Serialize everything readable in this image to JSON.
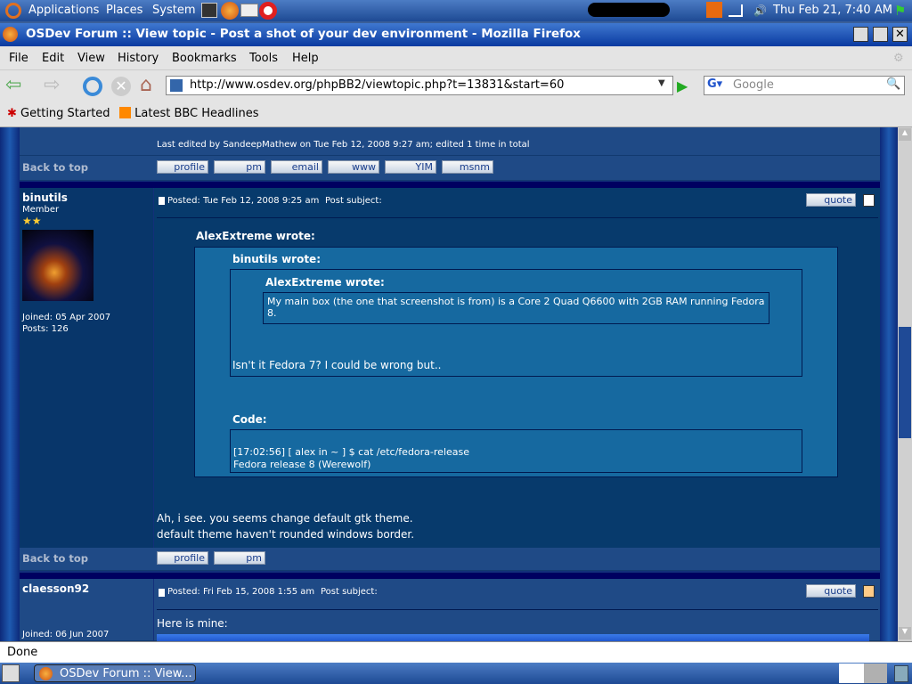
{
  "panel": {
    "applications": "Applications",
    "places": "Places",
    "system": "System",
    "clock": "Thu Feb 21,  7:40 AM"
  },
  "window": {
    "title": "OSDev Forum :: View topic - Post a shot of your dev environment - Mozilla Firefox"
  },
  "menu": [
    "File",
    "Edit",
    "View",
    "History",
    "Bookmarks",
    "Tools",
    "Help"
  ],
  "nav": {
    "url": "http://www.osdev.org/phpBB2/viewtopic.php?t=13831&start=60",
    "search_placeholder": "Google"
  },
  "bookmarks": [
    "Getting Started",
    "Latest BBC Headlines"
  ],
  "posts": {
    "prev": {
      "edited": "Last edited by SandeepMathew on Tue Feb 12, 2008 9:27 am; edited 1 time in total",
      "back_to_top": "Back to top",
      "buttons": [
        "profile",
        "pm",
        "email",
        "www",
        "YIM",
        "msnm"
      ]
    },
    "p1": {
      "author": "binutils",
      "rank": "Member",
      "joined": "Joined: 05 Apr 2007",
      "posts": "Posts: 126",
      "posted": "Posted: Tue Feb 12, 2008 9:25 am",
      "subject": "Post subject:",
      "quote_btn": "quote",
      "q1_label": "AlexExtreme wrote:",
      "q2_label": "binutils wrote:",
      "q3_label": "AlexExtreme wrote:",
      "q3_text": "My main box (the one that screenshot is from) is a Core 2 Quad Q6600 with 2GB RAM running Fedora 8.",
      "q2_text": "Isn't it Fedora 7? I could be wrong but..",
      "code_label": "Code:",
      "code_lines": [
        "[17:02:56] [ alex in ~ ] $ cat /etc/fedora-release",
        "Fedora release 8 (Werewolf)"
      ],
      "body_lines": [
        "Ah, i see. you seems change default gtk theme.",
        "default theme haven't rounded windows border."
      ],
      "back_to_top": "Back to top",
      "buttons": [
        "profile",
        "pm"
      ]
    },
    "p2": {
      "author": "claesson92",
      "joined": "Joined: 06 Jun 2007",
      "posted": "Posted: Fri Feb 15, 2008 1:55 am",
      "subject": "Post subject:",
      "quote_btn": "quote",
      "body": "Here is mine:"
    }
  },
  "status": "Done",
  "taskbar": {
    "item": "OSDev Forum :: View..."
  }
}
